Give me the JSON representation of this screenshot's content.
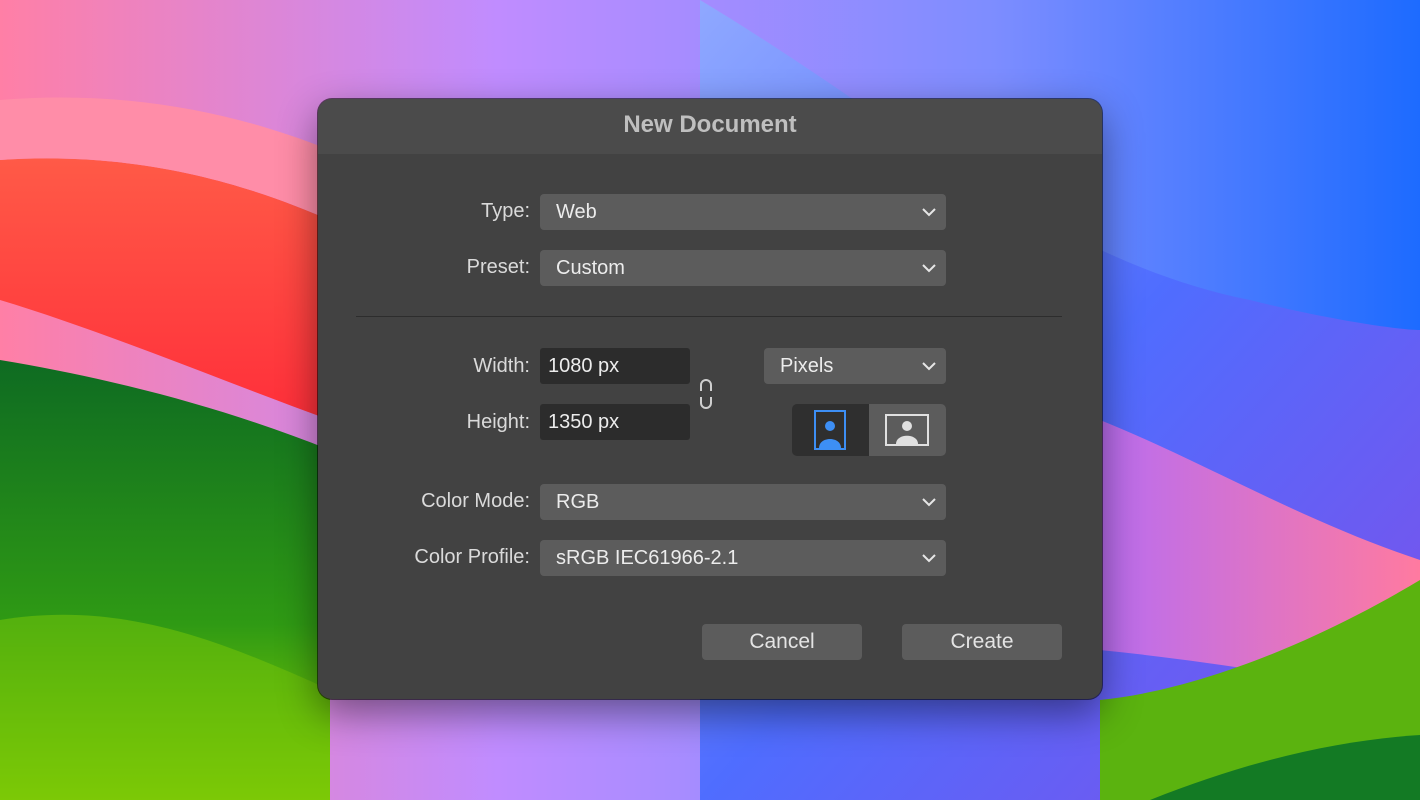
{
  "dialog": {
    "title": "New Document",
    "type": {
      "label": "Type:",
      "value": "Web"
    },
    "preset": {
      "label": "Preset:",
      "value": "Custom"
    },
    "width": {
      "label": "Width:",
      "value": "1080 px"
    },
    "height": {
      "label": "Height:",
      "value": "1350 px"
    },
    "units": {
      "value": "Pixels"
    },
    "orientation": {
      "selected": "portrait",
      "options": [
        "portrait",
        "landscape"
      ]
    },
    "color_mode": {
      "label": "Color Mode:",
      "value": "RGB"
    },
    "color_profile": {
      "label": "Color Profile:",
      "value": "sRGB IEC61966-2.1"
    },
    "buttons": {
      "cancel": "Cancel",
      "create": "Create"
    },
    "icons": {
      "chevron": "chevron-down-icon",
      "link": "link-chain-icon",
      "portrait": "portrait-person-icon",
      "landscape": "landscape-person-icon"
    },
    "colors": {
      "accent": "#3d8ff5",
      "dialog_bg": "#424242",
      "control_bg": "#5c5c5c",
      "field_bg": "#2c2c2c"
    }
  }
}
